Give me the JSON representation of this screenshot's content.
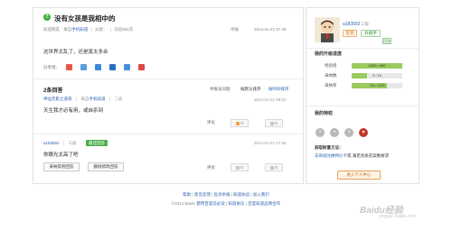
{
  "question": {
    "badge": "?",
    "title": "没有女孩是我相中的",
    "meta_source": "知道网友",
    "meta_from_prefix": "来自",
    "meta_from_link": "手机知道",
    "meta_cat1": "分类：",
    "meta_cat2": "浏览582次",
    "report": "举报",
    "time": "2014-01-21 07:48",
    "body": "这世界太乱了，还是寞太多余",
    "share_label": "分享到："
  },
  "answers": {
    "count_label": "2条回答",
    "report": "举报该问题",
    "sort_current": "按默认排序",
    "sort_alt": "按时间排序",
    "list": [
      {
        "user": "神仙无影之道哥",
        "from_prefix": "来自",
        "from_link": "手机知道",
        "level": "二级",
        "time": "2014-01-21 09:02",
        "text": "天生我才必有用，或自杀到",
        "comment": "评论",
        "up": "0",
        "down": "0"
      },
      {
        "user": "a183592",
        "level": "三级",
        "badge": "最佳回答",
        "time": "2014-01-21 07:55",
        "text": "你眼光太高了吧",
        "btn_accept": "采纳其他回答",
        "btn_edit": "删除修改回答",
        "comment": "评论",
        "up": "0",
        "down": "0"
      }
    ]
  },
  "footer": {
    "line1": [
      "帮助",
      "意见反馈",
      "投诉举报",
      "知道协议",
      "加入我们"
    ],
    "line2_prefix": "©2014 Baidu",
    "line2_links": [
      "使用百度前必读",
      "知道协议",
      "百度知道品牌合作"
    ]
  },
  "sidebar": {
    "username": "a183592",
    "level": "三级",
    "btn_signin": "签到",
    "btn_upgrade": "升级手",
    "tag": "回答",
    "section_upgrade": "我的升级进度",
    "stats": [
      {
        "label": "经验值",
        "value": "1009 / 800",
        "fraction": 1.0
      },
      {
        "label": "采纳数",
        "value": "3 / 10",
        "fraction": 0.3
      },
      {
        "label": "采纳率",
        "value": "7% / 10%",
        "fraction": 0.7
      }
    ],
    "section_priv": "我的特权",
    "coins_label": "获取财富方法：",
    "coins_text_link": "去商城兑换特价卡",
    "coins_text_rest": "或 满足优质答案数要求",
    "ucenter": "进入个人中心"
  },
  "watermark": {
    "brand": "Baidu经验",
    "sub": "jingyan.baidu.com"
  },
  "colors": {
    "accent": "#2d64b3",
    "green": "#4cae4c",
    "orange": "#e46b0c"
  }
}
